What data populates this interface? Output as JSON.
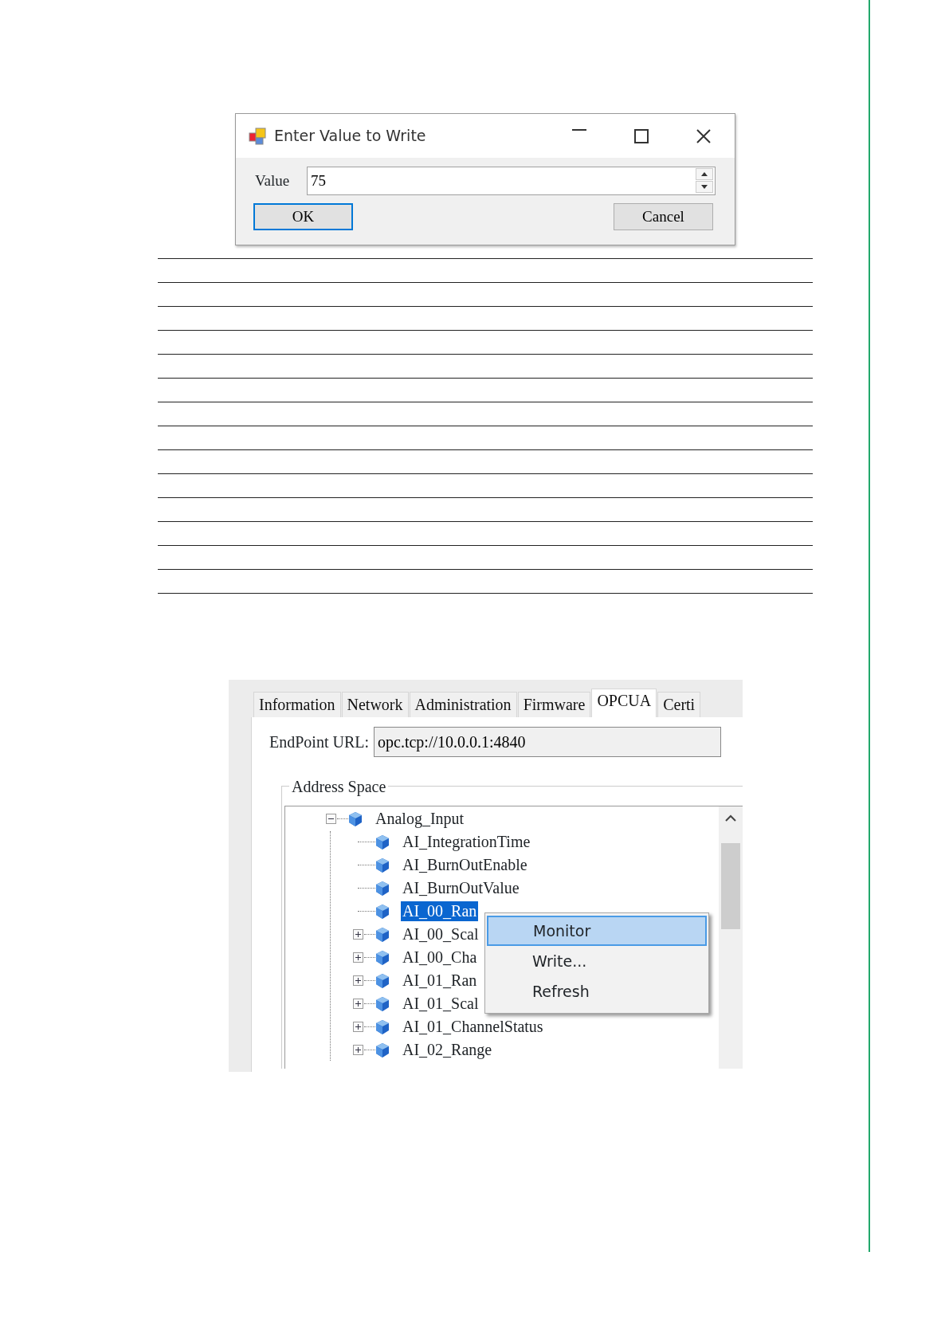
{
  "dialog": {
    "title": "Enter Value to Write",
    "value_label": "Value",
    "value": "75",
    "buttons": [
      {
        "label": "OK",
        "default": true
      },
      {
        "label": "Cancel",
        "default": false
      }
    ]
  },
  "config": {
    "tabs": [
      {
        "label": "Information",
        "selected": false
      },
      {
        "label": "Network",
        "selected": false
      },
      {
        "label": "Administration",
        "selected": false
      },
      {
        "label": "Firmware",
        "selected": false
      },
      {
        "label": "OPCUA",
        "selected": true
      },
      {
        "label": "Certi",
        "selected": false
      }
    ],
    "endpoint_label": "EndPoint URL:",
    "endpoint_url": "opc.tcp://10.0.0.1:4840",
    "group_title": "Address Space",
    "tree": [
      {
        "label": "Analog_Input",
        "expanded": true,
        "selected": false,
        "children": [
          {
            "label": "AI_IntegrationTime",
            "expandable": false,
            "selected": false
          },
          {
            "label": "AI_BurnOutEnable",
            "expandable": false,
            "selected": false
          },
          {
            "label": "AI_BurnOutValue",
            "expandable": false,
            "selected": false
          },
          {
            "label": "AI_00_Ran",
            "expandable": false,
            "selected": true
          },
          {
            "label": "AI_00_Scal",
            "expandable": true,
            "selected": false
          },
          {
            "label": "AI_00_Cha",
            "expandable": true,
            "selected": false
          },
          {
            "label": "AI_01_Ran",
            "expandable": true,
            "selected": false
          },
          {
            "label": "AI_01_Scal",
            "expandable": true,
            "selected": false
          },
          {
            "label": "AI_01_ChannelStatus",
            "expandable": true,
            "selected": false
          },
          {
            "label": "AI_02_Range",
            "expandable": true,
            "selected": false
          }
        ]
      }
    ],
    "context_menu": [
      {
        "label": "Monitor",
        "selected": true
      },
      {
        "label": "Write...",
        "selected": false
      },
      {
        "label": "Refresh",
        "selected": false
      }
    ]
  }
}
